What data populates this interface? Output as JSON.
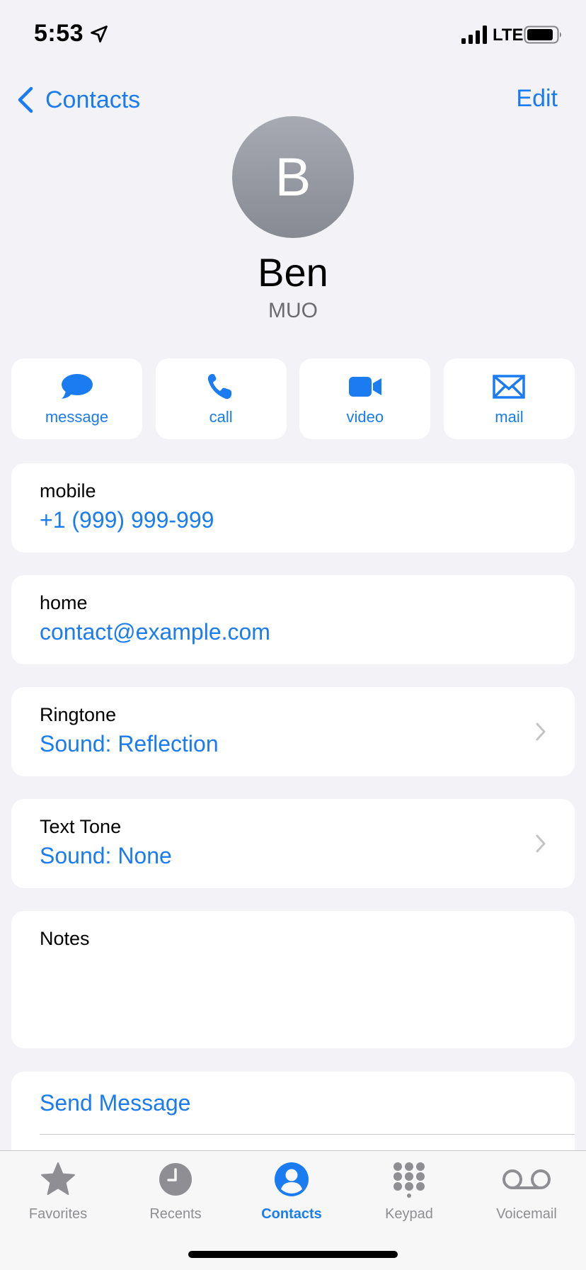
{
  "status_bar": {
    "time": "5:53",
    "network": "LTE"
  },
  "nav": {
    "back_label": "Contacts",
    "edit_label": "Edit"
  },
  "contact": {
    "initial": "B",
    "name": "Ben",
    "company": "MUO"
  },
  "actions": [
    {
      "label": "message",
      "icon": "message-bubble-icon"
    },
    {
      "label": "call",
      "icon": "phone-icon"
    },
    {
      "label": "video",
      "icon": "video-camera-icon"
    },
    {
      "label": "mail",
      "icon": "envelope-icon"
    }
  ],
  "fields": {
    "mobile": {
      "label": "mobile",
      "value": "+1 (999) 999-999"
    },
    "home": {
      "label": "home",
      "value": "contact@example.com"
    },
    "ringtone": {
      "label": "Ringtone",
      "value": "Sound: Reflection"
    },
    "text_tone": {
      "label": "Text Tone",
      "value": "Sound: None"
    },
    "notes": {
      "label": "Notes",
      "value": ""
    }
  },
  "links": {
    "send_message": "Send Message"
  },
  "tabs": [
    {
      "label": "Favorites",
      "icon": "star-icon",
      "active": false
    },
    {
      "label": "Recents",
      "icon": "clock-icon",
      "active": false
    },
    {
      "label": "Contacts",
      "icon": "person-circle-icon",
      "active": true
    },
    {
      "label": "Keypad",
      "icon": "keypad-icon",
      "active": false
    },
    {
      "label": "Voicemail",
      "icon": "voicemail-icon",
      "active": false
    }
  ],
  "colors": {
    "accent": "#1a7cf0",
    "background": "#f2f2f7",
    "card": "#ffffff",
    "inactive_tab": "#8e8e93"
  }
}
